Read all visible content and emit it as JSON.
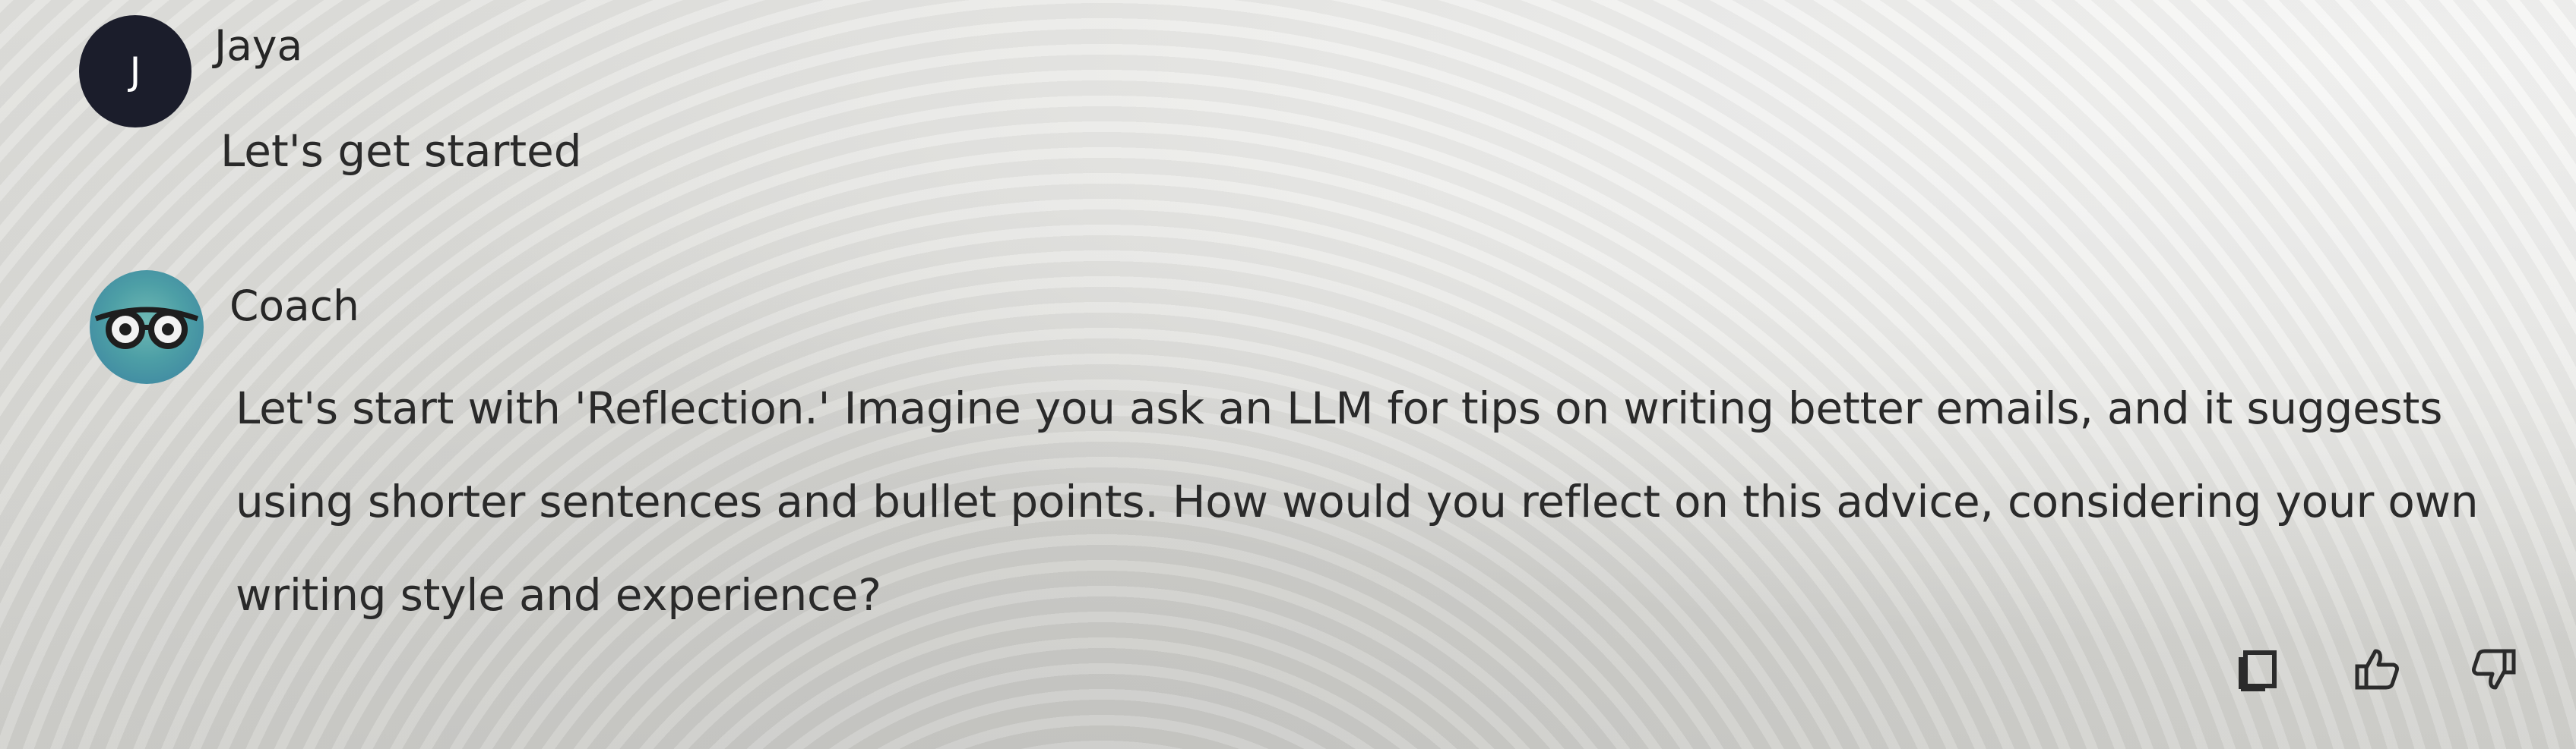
{
  "conversation": {
    "messages": [
      {
        "sender": "Jaya",
        "avatar_initial": "J",
        "text": "Let's get started"
      },
      {
        "sender": "Coach",
        "avatar_icon": "glasses-icon",
        "lines": [
          "Let's start with 'Reflection.' Imagine you ask an LLM for tips on writing better emails, and it suggests",
          "using shorter sentences and bullet points. How would you reflect on this advice, considering your own",
          "writing style and experience?"
        ]
      }
    ]
  },
  "actions": {
    "copy_icon": "copy-icon",
    "thumbs_up_icon": "thumbs-up-icon",
    "thumbs_down_icon": "thumbs-down-icon"
  },
  "colors": {
    "user_avatar_bg": "#1b1d2b",
    "coach_avatar_bg": "#4d9fa6",
    "text": "#2a2a2a"
  }
}
